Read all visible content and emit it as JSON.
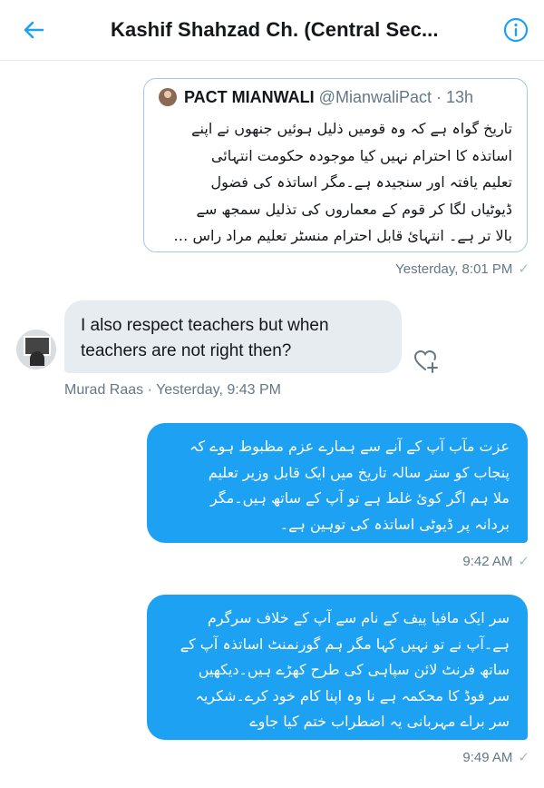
{
  "header": {
    "title": "Kashif Shahzad Ch. (Central Sec...",
    "back_icon": "arrow-left-icon",
    "info_icon": "info-icon"
  },
  "quoted_tweet": {
    "name": "PACT MIANWALI",
    "handle": "@MianwaliPact · 13h",
    "lines": [
      "تاریخ گواہ ہے کہ وہ قومیں ذلیل ہوئیں جنھوں نے اپنے",
      "اساتذہ کا احترام نہیں کیا موجودہ حکومت انتہائی",
      "تعلیم یافتہ اور سنجیدہ ہے۔مگر اساتذہ کی فضول",
      "ڈیوٹیاں لگا کر قوم کے معماروں کی تذلیل سمجھ سے",
      "بالا تر ہے۔ انتہائ قابل احترام منسٹر تعلیم مراد راس …"
    ],
    "time": "Yesterday, 8:01 PM",
    "status": "✓"
  },
  "incoming_message": {
    "text": "I also respect teachers but when teachers are not right then?",
    "sender": "Murad Raas",
    "time": "Murad Raas · Yesterday, 9:43 PM",
    "react_icon": "heart-plus-icon"
  },
  "outgoing_messages": [
    {
      "lines": [
        "عزت مآب آپ کے آنے سے ہمارے عزم مظبوط ہوے کہ",
        "پنجاب کو ستر سالہ تاریخ میں ایک قابل وزیر تعلیم",
        "ملا ہم اگر کوئ غلط ہے تو آپ کے ساتھ ہیں۔مگر",
        "بردانہ پر ڈیوٹی اساتذہ کی توہین ہے۔"
      ],
      "time": "9:42 AM",
      "status": "✓"
    },
    {
      "lines": [
        "سر ایک مافیا پیف کے نام سے آپ کے خلاف سرگرم",
        "ہے۔آپ نے تو نہیں کہا مگر ہم گورنمنٹ اساتذہ آپ کے",
        "ساتھ فرنٹ لائن سپاہی کی طرح کھڑے ہیں۔دیکھیں",
        "سر فوڈ کا محکمہ ہے نا وہ اپنا کام خود کرے۔شکریہ",
        "سر براے مہربانی یہ اضطراب ختم کیا جاوے"
      ],
      "time": "9:49 AM",
      "status": "✓"
    }
  ],
  "colors": {
    "accent": "#1da1f2",
    "incoming_bubble": "#e6ecf0",
    "meta_text": "#657786",
    "quote_border": "#9fc9ea"
  }
}
